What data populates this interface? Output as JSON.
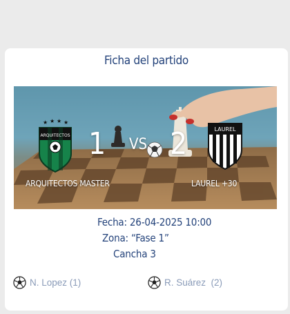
{
  "match": {
    "card_title": "Ficha del partido",
    "home_team": {
      "name": "ARQUITECTOS MASTER",
      "score": "1",
      "badge_text": "ARQUITECTOS"
    },
    "away_team": {
      "name": "LAUREL +30",
      "score": "2",
      "badge_text": "LAUREL"
    },
    "vs_label": "VS",
    "date_line": "Fecha: 26-04-2025 10:00",
    "zone_line": "Zona: “Fase 1”",
    "court_line": "Cancha 3",
    "scorers": [
      {
        "name": "N. Lopez (1)",
        "side": "home"
      },
      {
        "name": "R. Suárez  (2)",
        "side": "away"
      }
    ]
  },
  "colors": {
    "title": "#23427a",
    "scorer_text": "#8a9bb8",
    "home_badge_green": "#16834a",
    "away_badge_stripe": "#222222"
  }
}
